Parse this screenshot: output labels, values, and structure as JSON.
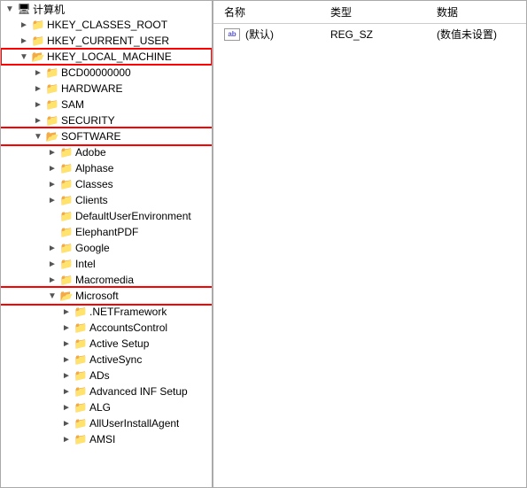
{
  "header": {
    "root_label": "计算机"
  },
  "detail": {
    "columns": [
      "名称",
      "类型",
      "数据"
    ],
    "rows": [
      {
        "name": "(默认)",
        "type": "REG_SZ",
        "data": "(数值未设置)",
        "icon": "ab"
      }
    ]
  },
  "tree": {
    "root": "计算机",
    "nodes": [
      {
        "id": "hkey_classes_root",
        "label": "HKEY_CLASSES_ROOT",
        "level": 1,
        "expanded": false,
        "highlight_box": false
      },
      {
        "id": "hkey_current_user",
        "label": "HKEY_CURRENT_USER",
        "level": 1,
        "expanded": false,
        "highlight_box": false
      },
      {
        "id": "hkey_local_machine",
        "label": "HKEY_LOCAL_MACHINE",
        "level": 1,
        "expanded": true,
        "highlight_box": true,
        "children": [
          {
            "id": "bcd",
            "label": "BCD00000000",
            "level": 2,
            "expanded": false
          },
          {
            "id": "hardware",
            "label": "HARDWARE",
            "level": 2,
            "expanded": false
          },
          {
            "id": "sam",
            "label": "SAM",
            "level": 2,
            "expanded": false
          },
          {
            "id": "security",
            "label": "SECURITY",
            "level": 2,
            "expanded": false
          },
          {
            "id": "software",
            "label": "SOFTWARE",
            "level": 2,
            "expanded": true,
            "highlight_box": true,
            "children": [
              {
                "id": "adobe",
                "label": "Adobe",
                "level": 3,
                "expanded": false
              },
              {
                "id": "alphase",
                "label": "Alphase",
                "level": 3,
                "expanded": false
              },
              {
                "id": "classes",
                "label": "Classes",
                "level": 3,
                "expanded": false
              },
              {
                "id": "clients",
                "label": "Clients",
                "level": 3,
                "expanded": false
              },
              {
                "id": "defaultuserenv",
                "label": "DefaultUserEnvironment",
                "level": 3,
                "expanded": false
              },
              {
                "id": "elephantpdf",
                "label": "ElephantPDF",
                "level": 3,
                "expanded": false
              },
              {
                "id": "google",
                "label": "Google",
                "level": 3,
                "expanded": false
              },
              {
                "id": "intel",
                "label": "Intel",
                "level": 3,
                "expanded": false
              },
              {
                "id": "macromedia",
                "label": "Macromedia",
                "level": 3,
                "expanded": false
              },
              {
                "id": "microsoft",
                "label": "Microsoft",
                "level": 3,
                "expanded": true,
                "highlight_box": true,
                "children": [
                  {
                    "id": "netframework",
                    "label": ".NETFramework",
                    "level": 4,
                    "expanded": false
                  },
                  {
                    "id": "accountscontrol",
                    "label": "AccountsControl",
                    "level": 4,
                    "expanded": false
                  },
                  {
                    "id": "activesetup",
                    "label": "Active Setup",
                    "level": 4,
                    "expanded": false
                  },
                  {
                    "id": "activesync",
                    "label": "ActiveSync",
                    "level": 4,
                    "expanded": false
                  },
                  {
                    "id": "ads",
                    "label": "ADs",
                    "level": 4,
                    "expanded": false
                  },
                  {
                    "id": "advancedinfsetup",
                    "label": "Advanced INF Setup",
                    "level": 4,
                    "expanded": false
                  },
                  {
                    "id": "alg",
                    "label": "ALG",
                    "level": 4,
                    "expanded": false
                  },
                  {
                    "id": "alluserinstallagent",
                    "label": "AllUserInstallAgent",
                    "level": 4,
                    "expanded": false
                  },
                  {
                    "id": "amsi",
                    "label": "AMSI",
                    "level": 4,
                    "expanded": false
                  }
                ]
              }
            ]
          }
        ]
      }
    ]
  }
}
